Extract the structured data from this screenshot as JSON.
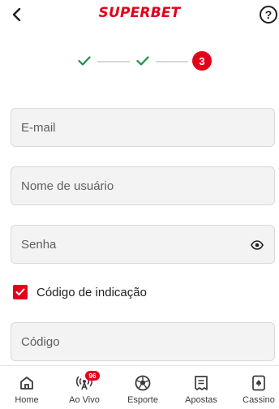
{
  "header": {
    "logo_text": "SUPERBET",
    "help_label": "?"
  },
  "stepper": {
    "current_step": "3"
  },
  "form": {
    "email_placeholder": "E-mail",
    "username_placeholder": "Nome de usuário",
    "password_placeholder": "Senha",
    "referral_label": "Código de indicação",
    "referral_checked": true,
    "code_placeholder": "Código"
  },
  "bottom_nav": {
    "items": [
      {
        "label": "Home",
        "icon": "home-icon"
      },
      {
        "label": "Ao Vivo",
        "icon": "live-broadcast-icon",
        "badge": "96"
      },
      {
        "label": "Esporte",
        "icon": "soccer-ball-icon"
      },
      {
        "label": "Apostas",
        "icon": "bet-slip-icon"
      },
      {
        "label": "Cassino",
        "icon": "playing-card-icon"
      }
    ]
  },
  "colors": {
    "brand_red": "#e3001b",
    "check_green": "#1e8f4e"
  }
}
